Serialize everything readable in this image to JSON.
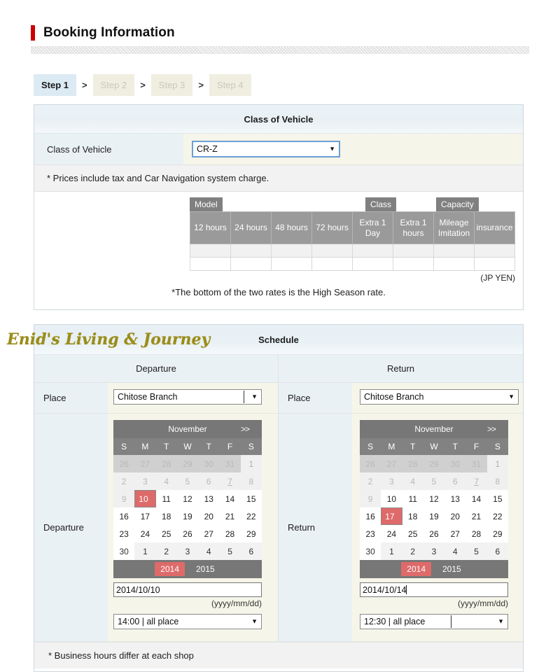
{
  "page": {
    "title": "Booking Information",
    "accent_color": "#cc0000"
  },
  "steps": {
    "separator": ">",
    "items": [
      {
        "label": "Step 1",
        "state": "active"
      },
      {
        "label": "Step 2",
        "state": "inactive"
      },
      {
        "label": "Step 3",
        "state": "inactive"
      },
      {
        "label": "Step 4",
        "state": "inactive"
      }
    ]
  },
  "vehicle": {
    "panel_title": "Class of Vehicle",
    "row_label": "Class of Vehicle",
    "selected": "CR-Z",
    "note": "* Prices include tax and Car Navigation system charge.",
    "tags": {
      "model": "Model",
      "class": "Class",
      "capacity": "Capacity"
    },
    "columns": [
      "12 hours",
      "24 hours",
      "48 hours",
      "72 hours",
      "Extra 1 Day",
      "Extra 1 hours",
      "Mileage Imitation",
      "insurance"
    ],
    "rows": [
      [
        "",
        "",
        "",
        "",
        "",
        "",
        "",
        ""
      ],
      [
        "",
        "",
        "",
        "",
        "",
        "",
        "",
        ""
      ]
    ],
    "currency_note": "(JP YEN)",
    "high_season_note": "*The bottom of the two rates is the High Season rate."
  },
  "schedule": {
    "panel_title": "Schedule",
    "brand": "Enid's Living & Journey",
    "note": "* Business hours differ at each shop",
    "departure": {
      "column_title": "Departure",
      "place_label": "Place",
      "place_value": "Chitose Branch",
      "row_label": "Departure",
      "date_value": "2014/10/10",
      "date_hint": "(yyyy/mm/dd)",
      "time_value": "14:00 | all place",
      "calendar": {
        "month": "November",
        "next_label": ">>",
        "dow": [
          "S",
          "M",
          "T",
          "W",
          "T",
          "F",
          "S"
        ],
        "weeks": [
          [
            "26",
            "27",
            "28",
            "29",
            "30",
            "31",
            "1"
          ],
          [
            "2",
            "3",
            "4",
            "5",
            "6",
            "7",
            "8"
          ],
          [
            "9",
            "10",
            "11",
            "12",
            "13",
            "14",
            "15"
          ],
          [
            "16",
            "17",
            "18",
            "19",
            "20",
            "21",
            "22"
          ],
          [
            "23",
            "24",
            "25",
            "26",
            "27",
            "28",
            "29"
          ],
          [
            "30",
            "1",
            "2",
            "3",
            "4",
            "5",
            "6"
          ]
        ],
        "selected_day": "10",
        "underlined_day": "7",
        "years": [
          "2014",
          "2015"
        ],
        "selected_year": "2014"
      }
    },
    "return": {
      "column_title": "Return",
      "place_label": "Place",
      "place_value": "Chitose Branch",
      "row_label": "Return",
      "date_value": "2014/10/14",
      "date_hint": "(yyyy/mm/dd)",
      "time_value": "12:30 | all place",
      "calendar": {
        "month": "November",
        "next_label": ">>",
        "dow": [
          "S",
          "M",
          "T",
          "W",
          "T",
          "F",
          "S"
        ],
        "weeks": [
          [
            "26",
            "27",
            "28",
            "29",
            "30",
            "31",
            "1"
          ],
          [
            "2",
            "3",
            "4",
            "5",
            "6",
            "7",
            "8"
          ],
          [
            "9",
            "10",
            "11",
            "12",
            "13",
            "14",
            "15"
          ],
          [
            "16",
            "17",
            "18",
            "19",
            "20",
            "21",
            "22"
          ],
          [
            "23",
            "24",
            "25",
            "26",
            "27",
            "28",
            "29"
          ],
          [
            "30",
            "1",
            "2",
            "3",
            "4",
            "5",
            "6"
          ]
        ],
        "selected_day": "17",
        "underlined_day": "7",
        "years": [
          "2014",
          "2015"
        ],
        "selected_year": "2014"
      }
    }
  }
}
